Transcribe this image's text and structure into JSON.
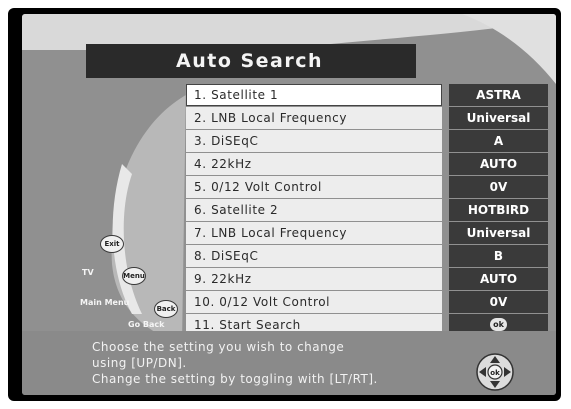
{
  "title": "Auto Search",
  "menu": [
    {
      "label": "1. Satellite 1",
      "value": "ASTRA",
      "selected": true
    },
    {
      "label": "2. LNB Local Frequency",
      "value": "Universal"
    },
    {
      "label": "3. DiSEqC",
      "value": "A"
    },
    {
      "label": "4. 22kHz",
      "value": "AUTO"
    },
    {
      "label": "5. 0/12 Volt Control",
      "value": "0V"
    },
    {
      "label": "6. Satellite 2",
      "value": "HOTBIRD"
    },
    {
      "label": "7. LNB Local Frequency",
      "value": "Universal"
    },
    {
      "label": "8. DiSEqC",
      "value": "B"
    },
    {
      "label": "9. 22kHz",
      "value": "AUTO"
    },
    {
      "label": "10. 0/12 Volt Control",
      "value": "0V"
    },
    {
      "label": "11. Start Search",
      "value": "ok"
    }
  ],
  "help": {
    "line1": "Choose the setting you wish to change",
    "line2": "using [UP/DN].",
    "line3": "Change the setting by toggling with [LT/RT]."
  },
  "side": {
    "exit_btn": "Exit",
    "tv": "TV",
    "menu_btn": "Menu",
    "main_menu": "Main Menu",
    "back_btn": "Back",
    "go_back": "Go Back"
  },
  "navpad_center": "ok",
  "colors": {
    "screen": "#909090",
    "title_bg": "#2a2a2a",
    "row_bg": "#ededed",
    "value_bg": "#3a3a3a",
    "help_bg": "#8a8a8a"
  }
}
